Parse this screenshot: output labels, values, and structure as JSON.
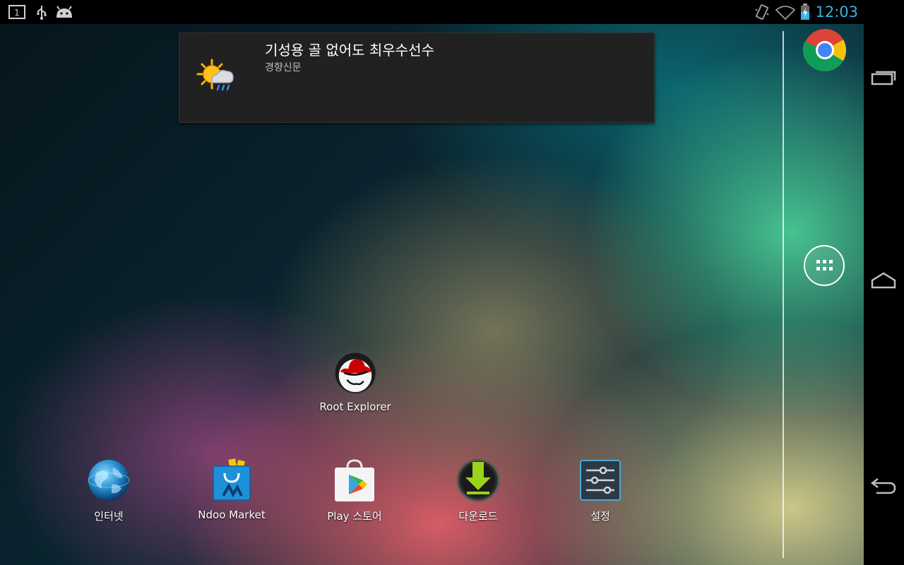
{
  "status_bar": {
    "clock": "12:03",
    "notification_badge": "1",
    "icons": [
      "notification-count-icon",
      "usb-icon",
      "android-debug-icon",
      "vibrate-icon",
      "wifi-icon",
      "battery-charging-icon"
    ],
    "accent": "#33b5e5"
  },
  "notification": {
    "title": "기성용 골 없어도 최우수선수",
    "source": "경향신문",
    "icon": "weather-icon"
  },
  "desktop": {
    "root_explorer_label": "Root Explorer"
  },
  "hotseat": {
    "apps": [
      {
        "label": "인터넷",
        "icon": "internet-globe-icon"
      },
      {
        "label": "Ndoo Market",
        "icon": "ndoo-market-icon"
      },
      {
        "label": "Play 스토어",
        "icon": "play-store-icon"
      },
      {
        "label": "다운로드",
        "icon": "download-icon"
      },
      {
        "label": "설정",
        "icon": "settings-icon"
      }
    ]
  },
  "dock": {
    "chrome_icon": "chrome-icon",
    "all_apps_icon": "all-apps-grid-icon"
  },
  "nav_bar": [
    "recent-apps-icon",
    "home-icon",
    "back-icon"
  ]
}
